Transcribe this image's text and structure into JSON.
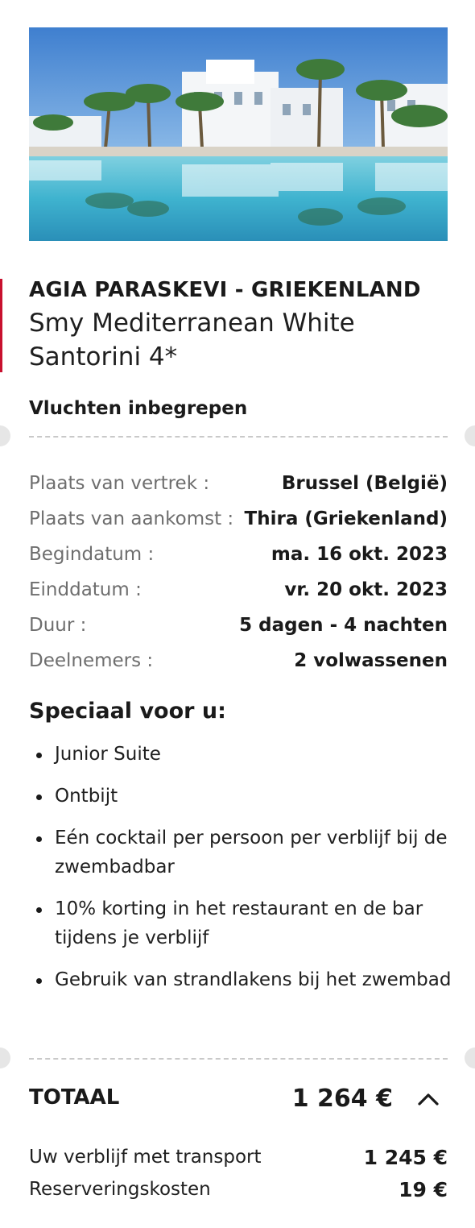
{
  "hotel": {
    "destination": "AGIA PARASKEVI - GRIEKENLAND",
    "name": "Smy Mediterranean White Santorini 4*",
    "flights_label": "Vluchten inbegrepen",
    "image_icon": "hotel-pool-photo"
  },
  "details": [
    {
      "label": "Plaats van vertrek :",
      "value": "Brussel (België)"
    },
    {
      "label": "Plaats van aankomst :",
      "value": "Thira (Griekenland)"
    },
    {
      "label": "Begindatum :",
      "value": "ma. 16 okt. 2023"
    },
    {
      "label": "Einddatum :",
      "value": "vr. 20 okt. 2023"
    },
    {
      "label": "Duur :",
      "value": "5 dagen - 4 nachten"
    },
    {
      "label": "Deelnemers :",
      "value": "2 volwassenen"
    }
  ],
  "special": {
    "title": "Speciaal voor u:",
    "items": [
      "Junior Suite",
      "Ontbijt",
      "Eén cocktail per persoon per verblijf bij de zwembadbar",
      "10% korting in het restaurant en de bar tijdens je verblijf",
      "Gebruik van strandlakens bij het zwembad"
    ]
  },
  "total": {
    "label": "TOTAAL",
    "value": "1 264 €",
    "toggle_icon": "chevron-up-icon",
    "breakdown": [
      {
        "label": "Uw verblijf met transport",
        "value": "1 245 €"
      },
      {
        "label": "Reserveringskosten",
        "value": "19 €"
      }
    ]
  },
  "colors": {
    "accent": "#c8102e",
    "muted_label": "#6e6e6e",
    "divider": "#c9c9c9"
  }
}
